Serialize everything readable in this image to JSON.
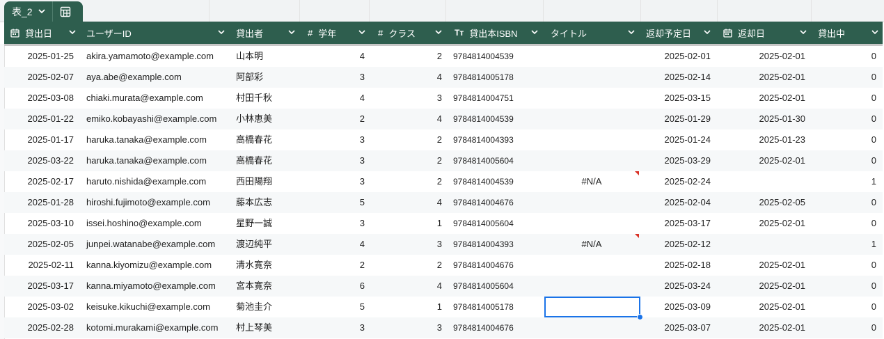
{
  "table_tab": {
    "name": "表_2"
  },
  "colors": {
    "header_bg": "#2e5e4e",
    "header_text": "#ffffff",
    "selection": "#1a73e8",
    "error_flag": "#d93025"
  },
  "columns": [
    {
      "key": "lend_date",
      "label": "貸出日",
      "icon": "calendar-icon"
    },
    {
      "key": "user_id",
      "label": "ユーザーID",
      "icon": ""
    },
    {
      "key": "borrower",
      "label": "貸出者",
      "icon": ""
    },
    {
      "key": "grade",
      "label": "学年",
      "icon": "number-icon"
    },
    {
      "key": "class",
      "label": "クラス",
      "icon": "number-icon"
    },
    {
      "key": "isbn",
      "label": "貸出本ISBN",
      "icon": "text-type-icon"
    },
    {
      "key": "title",
      "label": "タイトル",
      "icon": ""
    },
    {
      "key": "due_date",
      "label": "返却予定日",
      "icon": ""
    },
    {
      "key": "return_date",
      "label": "返却日",
      "icon": "calendar-icon"
    },
    {
      "key": "on_loan",
      "label": "貸出中",
      "icon": ""
    }
  ],
  "rows": [
    {
      "lend_date": "2025-01-25",
      "user_id": "akira.yamamoto@example.com",
      "borrower": "山本明",
      "grade": "4",
      "class": "2",
      "isbn": "9784814004539",
      "title": "",
      "due_date": "2025-02-01",
      "return_date": "2025-02-01",
      "on_loan": "0"
    },
    {
      "lend_date": "2025-02-07",
      "user_id": "aya.abe@example.com",
      "borrower": "阿部彩",
      "grade": "3",
      "class": "4",
      "isbn": "9784814005178",
      "title": "",
      "due_date": "2025-02-14",
      "return_date": "2025-02-01",
      "on_loan": "0"
    },
    {
      "lend_date": "2025-03-08",
      "user_id": "chiaki.murata@example.com",
      "borrower": "村田千秋",
      "grade": "4",
      "class": "3",
      "isbn": "9784814004751",
      "title": "",
      "due_date": "2025-03-15",
      "return_date": "2025-02-01",
      "on_loan": "0"
    },
    {
      "lend_date": "2025-01-22",
      "user_id": "emiko.kobayashi@example.com",
      "borrower": "小林恵美",
      "grade": "2",
      "class": "4",
      "isbn": "9784814004539",
      "title": "",
      "due_date": "2025-01-29",
      "return_date": "2025-01-30",
      "on_loan": "0"
    },
    {
      "lend_date": "2025-01-17",
      "user_id": "haruka.tanaka@example.com",
      "borrower": "高橋春花",
      "grade": "3",
      "class": "2",
      "isbn": "9784814004393",
      "title": "",
      "due_date": "2025-01-24",
      "return_date": "2025-01-23",
      "on_loan": "0"
    },
    {
      "lend_date": "2025-03-22",
      "user_id": "haruka.tanaka@example.com",
      "borrower": "高橋春花",
      "grade": "3",
      "class": "2",
      "isbn": "9784814005604",
      "title": "",
      "due_date": "2025-03-29",
      "return_date": "2025-02-01",
      "on_loan": "0"
    },
    {
      "lend_date": "2025-02-17",
      "user_id": "haruto.nishida@example.com",
      "borrower": "西田陽翔",
      "grade": "3",
      "class": "2",
      "isbn": "9784814004539",
      "title": "#N/A",
      "due_date": "2025-02-24",
      "return_date": "",
      "on_loan": "1"
    },
    {
      "lend_date": "2025-01-28",
      "user_id": "hiroshi.fujimoto@example.com",
      "borrower": "藤本広志",
      "grade": "5",
      "class": "4",
      "isbn": "9784814004676",
      "title": "",
      "due_date": "2025-02-04",
      "return_date": "2025-02-05",
      "on_loan": "0"
    },
    {
      "lend_date": "2025-03-10",
      "user_id": "issei.hoshino@example.com",
      "borrower": "星野一誠",
      "grade": "3",
      "class": "1",
      "isbn": "9784814005604",
      "title": "",
      "due_date": "2025-03-17",
      "return_date": "2025-02-01",
      "on_loan": "0"
    },
    {
      "lend_date": "2025-02-05",
      "user_id": "junpei.watanabe@example.com",
      "borrower": "渡辺純平",
      "grade": "4",
      "class": "3",
      "isbn": "9784814004393",
      "title": "#N/A",
      "due_date": "2025-02-12",
      "return_date": "",
      "on_loan": "1"
    },
    {
      "lend_date": "2025-02-11",
      "user_id": "kanna.kiyomizu@example.com",
      "borrower": "清水寛奈",
      "grade": "2",
      "class": "2",
      "isbn": "9784814004676",
      "title": "",
      "due_date": "2025-02-18",
      "return_date": "2025-02-01",
      "on_loan": "0"
    },
    {
      "lend_date": "2025-03-17",
      "user_id": "kanna.miyamoto@example.com",
      "borrower": "宮本寛奈",
      "grade": "6",
      "class": "4",
      "isbn": "9784814005604",
      "title": "",
      "due_date": "2025-03-24",
      "return_date": "2025-02-01",
      "on_loan": "0"
    },
    {
      "lend_date": "2025-03-02",
      "user_id": "keisuke.kikuchi@example.com",
      "borrower": "菊池圭介",
      "grade": "5",
      "class": "1",
      "isbn": "9784814005178",
      "title": "",
      "due_date": "2025-03-09",
      "return_date": "2025-02-01",
      "on_loan": "0"
    },
    {
      "lend_date": "2025-02-28",
      "user_id": "kotomi.murakami@example.com",
      "borrower": "村上琴美",
      "grade": "3",
      "class": "3",
      "isbn": "9784814004676",
      "title": "",
      "due_date": "2025-03-07",
      "return_date": "2025-02-01",
      "on_loan": "0"
    }
  ]
}
